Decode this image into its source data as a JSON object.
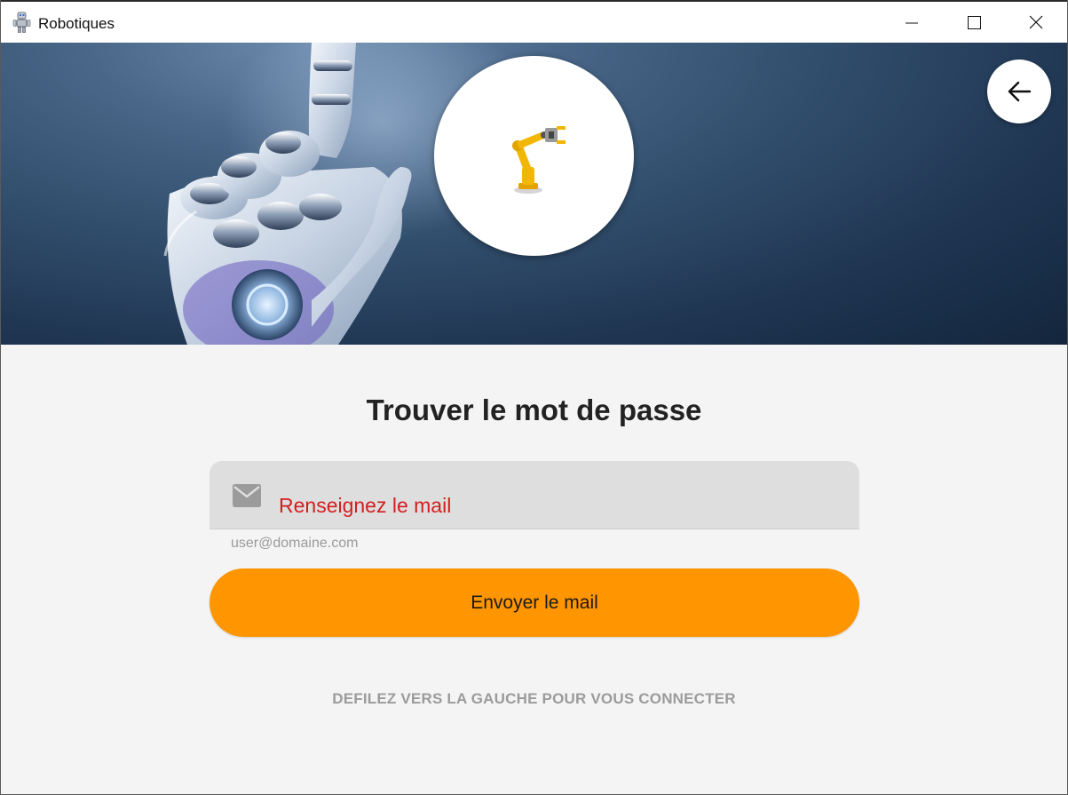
{
  "window": {
    "title": "Robotiques",
    "controls": [
      "minimize",
      "maximize",
      "close"
    ]
  },
  "hero": {
    "background_image": "robot-hand",
    "logo": "industrial-robot-arm",
    "back_icon": "arrow-left-icon"
  },
  "form": {
    "title": "Trouver le mot de passe",
    "email_field": {
      "icon": "mail-icon",
      "label": "Renseignez le mail",
      "helper": "user@domaine.com",
      "value": ""
    },
    "send_button": "Envoyer le mail",
    "swipe_hint": "DEFILEZ VERS LA GAUCHE POUR VOUS CONNECTER"
  },
  "colors": {
    "accent": "#ff9500",
    "error_label": "#d21f1f",
    "hero_dark": "#1e3450",
    "background": "#f4f4f4"
  }
}
